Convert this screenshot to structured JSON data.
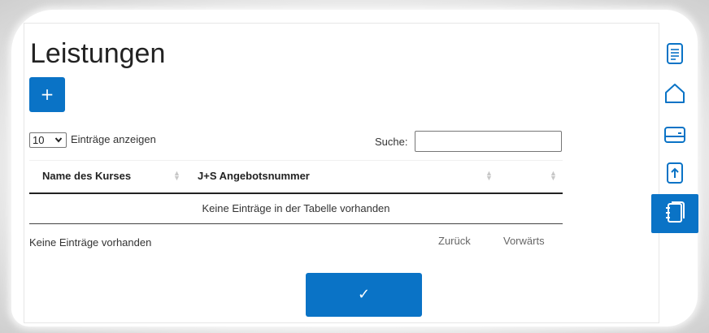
{
  "page": {
    "title": "Leistungen",
    "add_label": "+",
    "confirm_label": "✓"
  },
  "table_controls": {
    "length_value": "10",
    "length_label": "Einträge anzeigen",
    "search_label": "Suche:",
    "search_value": ""
  },
  "table": {
    "columns": [
      {
        "label": "Name des Kurses"
      },
      {
        "label": "J+S Angebotsnummer"
      },
      {
        "label": ""
      }
    ],
    "empty_text": "Keine Einträge in der Tabelle vorhanden"
  },
  "footer": {
    "info": "Keine Einträge vorhanden",
    "prev_label": "Zurück",
    "next_label": "Vorwärts"
  },
  "sidebar": {
    "items": [
      {
        "icon": "document-icon",
        "active": false
      },
      {
        "icon": "home-icon",
        "active": false
      },
      {
        "icon": "card-icon",
        "active": false
      },
      {
        "icon": "upload-file-icon",
        "active": false
      },
      {
        "icon": "notebook-icon",
        "active": true
      }
    ]
  },
  "colors": {
    "accent": "#0a73c6",
    "icon": "#0a73c6",
    "text": "#222222"
  }
}
